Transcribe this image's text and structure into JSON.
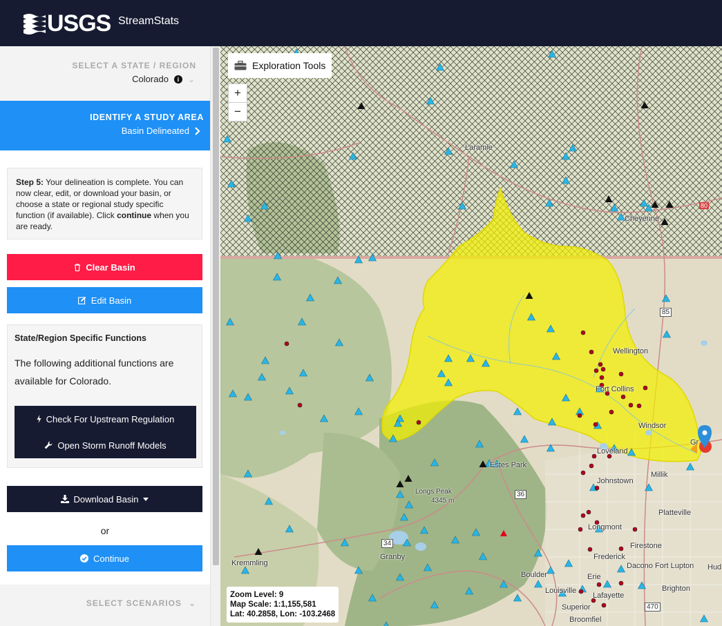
{
  "header": {
    "logo_text": "USGS",
    "app_name": "StreamStats"
  },
  "sidebar": {
    "state_section": {
      "label": "SELECT A STATE / REGION",
      "value": "Colorado"
    },
    "study_section": {
      "title": "IDENTIFY A STUDY AREA",
      "status": "Basin Delineated"
    },
    "step": {
      "prefix": "Step 5:",
      "text_1": " Your delineation is complete. You can now clear, edit, or download your basin, or choose a state or regional study specific function (if available). Click ",
      "bold": "continue",
      "text_2": " when you are ready."
    },
    "clear_button": "Clear Basin",
    "edit_button": "Edit Basin",
    "functions": {
      "title": "State/Region Specific Functions",
      "text": "The following additional functions are available for Colorado.",
      "check_button": "Check For Upstream Regulation",
      "storm_button": "Open Storm Runoff Models"
    },
    "download_button": "Download Basin",
    "or_text": "or",
    "continue_button": "Continue",
    "scenarios_label": "SELECT SCENARIOS"
  },
  "map": {
    "tools_label": "Exploration Tools",
    "zoom_in": "+",
    "zoom_out": "−",
    "zoom_level": "Zoom Level: 9",
    "map_scale": "Map Scale: 1:1,155,581",
    "lat_lon": "Lat: 40.2858, Lon: -103.2468",
    "places": {
      "laramie": "Laramie",
      "cheyenne": "Cheyenne",
      "wellington": "Wellington",
      "fort_collins": "Fort Collins",
      "windsor": "Windsor",
      "loveland": "Loveland",
      "estes_park": "Estes Park",
      "johnstown": "Johnstown",
      "milliken": "Millik",
      "platteville": "Platteville",
      "longs_peak": "Longs Peak",
      "longs_peak_elev": "4345 m",
      "longmont": "Longmont",
      "firestone": "Firestone",
      "frederick": "Frederick",
      "dacono": "Dacono",
      "fort_lupton": "Fort Lupton",
      "hudson": "Hud",
      "boulder": "Boulder",
      "erie": "Erie",
      "brighton": "Brighton",
      "louisville": "Louisville",
      "lafayette": "Lafayette",
      "superior": "Superior",
      "broomfield": "Broomfiel",
      "granby": "Granby",
      "kremmling": "Kremmling",
      "greeley": "Gr",
      "hwy_85": "85",
      "hwy_36": "36",
      "hwy_34": "34",
      "hwy_470": "470",
      "hwy_80": "80"
    },
    "colors": {
      "basin": "#f2f000",
      "water_sites": "#29b6e6",
      "header_bg": "#171b31",
      "accent_blue": "#1e90f6",
      "clear_red": "#ff1c46"
    }
  }
}
